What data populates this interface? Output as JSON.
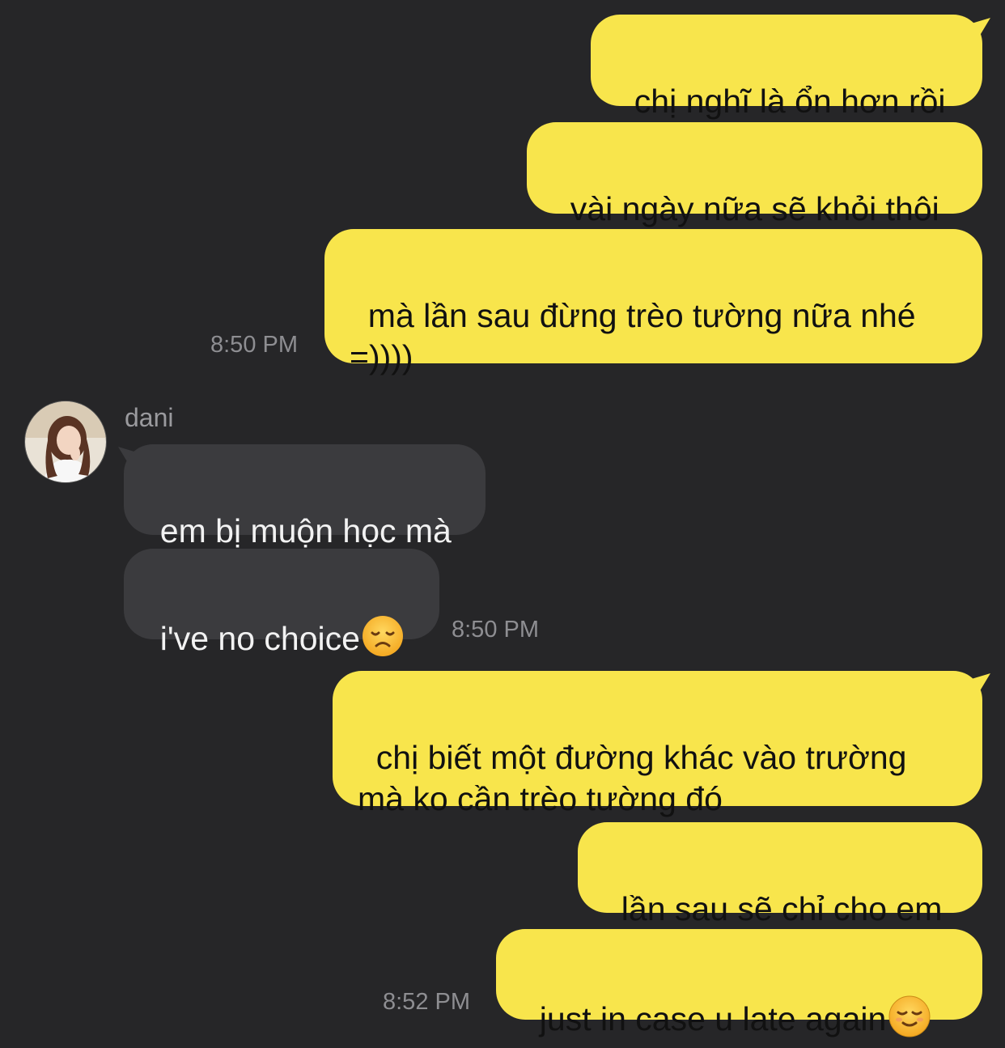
{
  "messages_out_1": [
    "chị nghĩ là ổn hơn rồi",
    "vài ngày nữa sẽ khỏi thôi",
    "mà lần sau đừng trèo tường nữa nhé\n=))))"
  ],
  "time_1": "8:50 PM",
  "incoming": {
    "sender": "dani",
    "messages": [
      "em bị muộn học mà",
      "i've no choice"
    ],
    "emoji": "disappointed-face-icon",
    "time": "8:50 PM"
  },
  "messages_out_2": [
    "chị biết một đường khác vào trường\nmà ko cần trèo tường đó",
    "lần sau sẽ chỉ cho em",
    "just in case u late again"
  ],
  "out_2_emoji": "relieved-face-icon",
  "time_2": "8:52 PM",
  "colors": {
    "background": "#262628",
    "outgoing_bubble": "#f8e54c",
    "incoming_bubble": "#3b3b3e",
    "timestamp": "#8e8e92"
  }
}
